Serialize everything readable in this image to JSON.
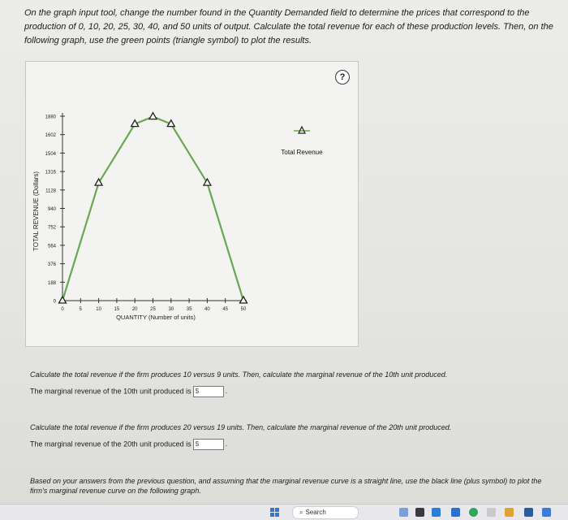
{
  "instructions": "On the graph input tool, change the number found in the Quantity Demanded field to determine the prices that correspond to the production of 0, 10, 20, 25, 30, 40, and 50 units of output. Calculate the total revenue for each of these production levels. Then, on the following graph, use the green points (triangle symbol) to plot the results.",
  "help_label": "?",
  "legend_label": "Total Revenue",
  "chart_data": {
    "type": "line",
    "xlabel": "QUANTITY (Number of units)",
    "ylabel": "TOTAL REVENUE (Dollars)",
    "x_ticks": [
      0,
      5,
      10,
      15,
      20,
      25,
      30,
      35,
      40,
      45,
      50
    ],
    "y_ticks": [
      0,
      188,
      376,
      564,
      752,
      940,
      1128,
      1316,
      1504,
      1692,
      1880
    ],
    "y_tick_labels": [
      "0",
      "188",
      "376",
      "564",
      "752",
      "940",
      "1128",
      "1316",
      "1504",
      "1602",
      "1880"
    ],
    "xlim": [
      0,
      50
    ],
    "ylim": [
      0,
      1880
    ],
    "series": [
      {
        "name": "Total Revenue",
        "color": "#6aa84f",
        "marker": "triangle",
        "x": [
          0,
          10,
          20,
          25,
          30,
          40,
          50
        ],
        "y": [
          0,
          1200,
          1800,
          1875,
          1800,
          1200,
          0
        ]
      }
    ]
  },
  "question1": "Calculate the total revenue if the firm produces 10 versus 9 units. Then, calculate the marginal revenue of the 10th unit produced.",
  "answer1_label": "The marginal revenue of the 10th unit produced is",
  "question2": "Calculate the total revenue if the firm produces 20 versus 19 units. Then, calculate the marginal revenue of the 20th unit produced.",
  "answer2_label": "The marginal revenue of the 20th unit produced is",
  "currency": "$",
  "period": ".",
  "question3": "Based on your answers from the previous question, and assuming that the marginal revenue curve is a straight line, use the black line (plus symbol) to plot the firm's marginal revenue curve on the following graph.",
  "taskbar": {
    "search_label": "Search"
  }
}
